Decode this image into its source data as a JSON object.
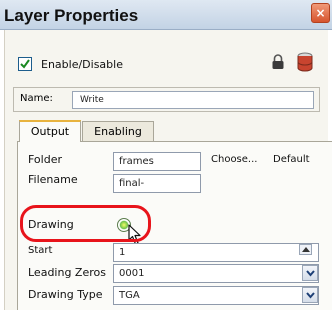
{
  "window": {
    "title": "Layer Properties",
    "close_glyph": "×"
  },
  "header": {
    "enable_label": "Enable/Disable",
    "enable_checked": true,
    "icons": [
      "lock-icon",
      "database-icon"
    ]
  },
  "name": {
    "label": "Name:",
    "value": "Write"
  },
  "tabs": [
    {
      "label": "Output",
      "active": true
    },
    {
      "label": "Enabling",
      "active": false
    }
  ],
  "output": {
    "folder_label": "Folder",
    "folder_value": "frames",
    "choose_label": "Choose...",
    "default_label": "Default",
    "filename_label": "Filename",
    "filename_value": "final-",
    "drawing_label": "Drawing",
    "start_label": "Start",
    "start_value": "1",
    "leading_zeros_label": "Leading Zeros",
    "leading_zeros_value": "0001",
    "drawing_type_label": "Drawing Type",
    "drawing_type_value": "TGA"
  },
  "colors": {
    "highlight": "#e8141b",
    "checkbox_border": "#1d5d8c"
  }
}
